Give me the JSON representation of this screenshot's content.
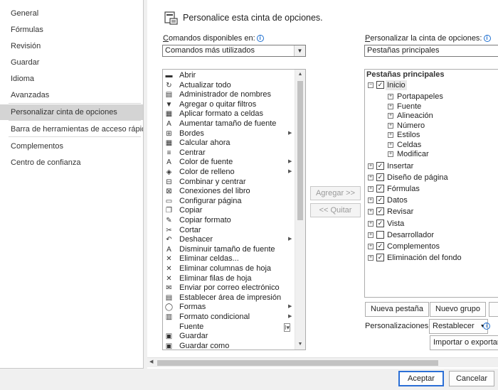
{
  "sidebar": {
    "items": [
      {
        "label": "General"
      },
      {
        "label": "Fórmulas"
      },
      {
        "label": "Revisión"
      },
      {
        "label": "Guardar"
      },
      {
        "label": "Idioma"
      },
      {
        "label": "Avanzadas"
      },
      {
        "label": "Personalizar cinta de opciones",
        "selected": true
      },
      {
        "label": "Barra de herramientas de acceso rápido"
      },
      {
        "label": "Complementos"
      },
      {
        "label": "Centro de confianza"
      }
    ]
  },
  "header": {
    "title": "Personalice esta cinta de opciones."
  },
  "left": {
    "label_u": "C",
    "label_rest": "omandos disponibles en:",
    "combo_value": "Comandos más utilizados",
    "commands": [
      {
        "label": "Abrir",
        "icon": "open-folder-icon",
        "glyph": "▬"
      },
      {
        "label": "Actualizar todo",
        "icon": "refresh-icon",
        "glyph": "↻"
      },
      {
        "label": "Administrador de nombres",
        "icon": "name-manager-icon",
        "glyph": "▤"
      },
      {
        "label": "Agregar o quitar filtros",
        "icon": "filter-icon",
        "glyph": "▼"
      },
      {
        "label": "Aplicar formato a celdas",
        "icon": "format-cells-icon",
        "glyph": "▦"
      },
      {
        "label": "Aumentar tamaño de fuente",
        "icon": "font-grow-icon",
        "glyph": "A"
      },
      {
        "label": "Bordes",
        "icon": "borders-icon",
        "glyph": "⊞",
        "sub": true
      },
      {
        "label": "Calcular ahora",
        "icon": "calculator-icon",
        "glyph": "▦"
      },
      {
        "label": "Centrar",
        "icon": "align-center-icon",
        "glyph": "≡"
      },
      {
        "label": "Color de fuente",
        "icon": "font-color-icon",
        "glyph": "A",
        "sub": true
      },
      {
        "label": "Color de relleno",
        "icon": "fill-color-icon",
        "glyph": "◈",
        "sub": true
      },
      {
        "label": "Combinar y centrar",
        "icon": "merge-center-icon",
        "glyph": "⊟"
      },
      {
        "label": "Conexiones del libro",
        "icon": "connections-icon",
        "glyph": "⊠"
      },
      {
        "label": "Configurar página",
        "icon": "page-setup-icon",
        "glyph": "▭"
      },
      {
        "label": "Copiar",
        "icon": "copy-icon",
        "glyph": "❐"
      },
      {
        "label": "Copiar formato",
        "icon": "format-painter-icon",
        "glyph": "✎"
      },
      {
        "label": "Cortar",
        "icon": "scissors-icon",
        "glyph": "✂"
      },
      {
        "label": "Deshacer",
        "icon": "undo-icon",
        "glyph": "↶",
        "sub": true
      },
      {
        "label": "Disminuir tamaño de fuente",
        "icon": "font-shrink-icon",
        "glyph": "A"
      },
      {
        "label": "Eliminar celdas...",
        "icon": "delete-cells-icon",
        "glyph": "✕"
      },
      {
        "label": "Eliminar columnas de hoja",
        "icon": "delete-columns-icon",
        "glyph": "✕"
      },
      {
        "label": "Eliminar filas de hoja",
        "icon": "delete-rows-icon",
        "glyph": "✕"
      },
      {
        "label": "Enviar por correo electrónico",
        "icon": "email-icon",
        "glyph": "✉"
      },
      {
        "label": "Establecer área de impresión",
        "icon": "print-area-icon",
        "glyph": "▤"
      },
      {
        "label": "Formas",
        "icon": "shapes-icon",
        "glyph": "◯",
        "sub": true
      },
      {
        "label": "Formato condicional",
        "icon": "conditional-format-icon",
        "glyph": "▥",
        "sub": true
      },
      {
        "label": "Fuente",
        "icon": "font-icon",
        "glyph": "",
        "combo": true
      },
      {
        "label": "Guardar",
        "icon": "save-icon",
        "glyph": "▣"
      },
      {
        "label": "Guardar como",
        "icon": "save-as-icon",
        "glyph": "▣"
      }
    ]
  },
  "middle": {
    "add": "Agregar >>",
    "remove": "<< Quitar"
  },
  "right": {
    "label_u": "P",
    "label_rest": "ersonalizar la cinta de opciones:",
    "combo_value": "Pestañas principales",
    "tree_header": "Pestañas principales",
    "tabs": [
      {
        "label": "Inicio",
        "expanded": true,
        "checked": true,
        "children": [
          "Portapapeles",
          "Fuente",
          "Alineación",
          "Número",
          "Estilos",
          "Celdas",
          "Modificar"
        ]
      },
      {
        "label": "Insertar",
        "checked": true
      },
      {
        "label": "Diseño de página",
        "checked": true
      },
      {
        "label": "Fórmulas",
        "checked": true
      },
      {
        "label": "Datos",
        "checked": true
      },
      {
        "label": "Revisar",
        "checked": true
      },
      {
        "label": "Vista",
        "checked": true
      },
      {
        "label": "Desarrollador",
        "checked": false
      },
      {
        "label": "Complementos",
        "checked": true
      },
      {
        "label": "Eliminación del fondo",
        "checked": true
      }
    ],
    "new_tab": "Nueva pestaña",
    "new_group": "Nuevo grupo",
    "customizations_label": "Personalizaciones:",
    "reset": "Restablecer",
    "import_export": "Importar o exportar"
  },
  "footer": {
    "ok": "Aceptar",
    "cancel": "Cancelar"
  }
}
